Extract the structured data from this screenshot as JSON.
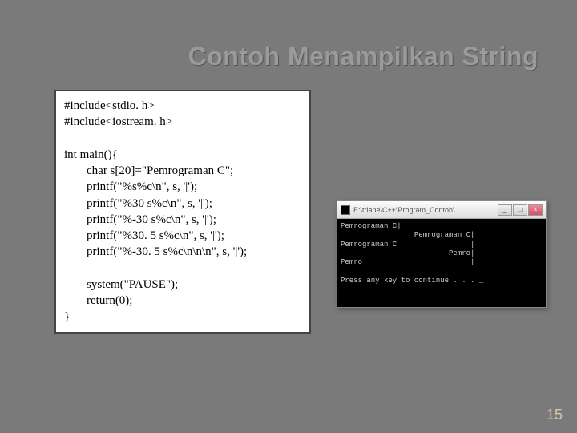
{
  "title": "Contoh Menampilkan String",
  "code": {
    "l1": "#include<stdio. h>",
    "l2": "#include<iostream. h>",
    "l3": "int main(){",
    "l4": "char s[20]=\"Pemrograman C\";",
    "l5": "printf(\"%s%c\\n\", s, '|');",
    "l6": "printf(\"%30 s%c\\n\", s, '|');",
    "l7": "printf(\"%-30 s%c\\n\", s, '|');",
    "l8": "printf(\"%30. 5 s%c\\n\", s, '|');",
    "l9": "printf(\"%-30. 5 s%c\\n\\n\\n\", s, '|');",
    "l10": "system(\"PAUSE\");",
    "l11": "return(0);",
    "l12": "}"
  },
  "console": {
    "path": "E:\\triane\\C++\\Program_Contoh\\...",
    "min_label": "_",
    "max_label": "□",
    "close_label": "×",
    "out1": "Pemrograman C|",
    "out2": "                 Pemrograman C|",
    "out3": "Pemrograman C                 |",
    "out4": "                         Pemro|",
    "out5": "Pemro                         |",
    "out6": "",
    "out7": "Press any key to continue . . . _"
  },
  "page_number": "15"
}
